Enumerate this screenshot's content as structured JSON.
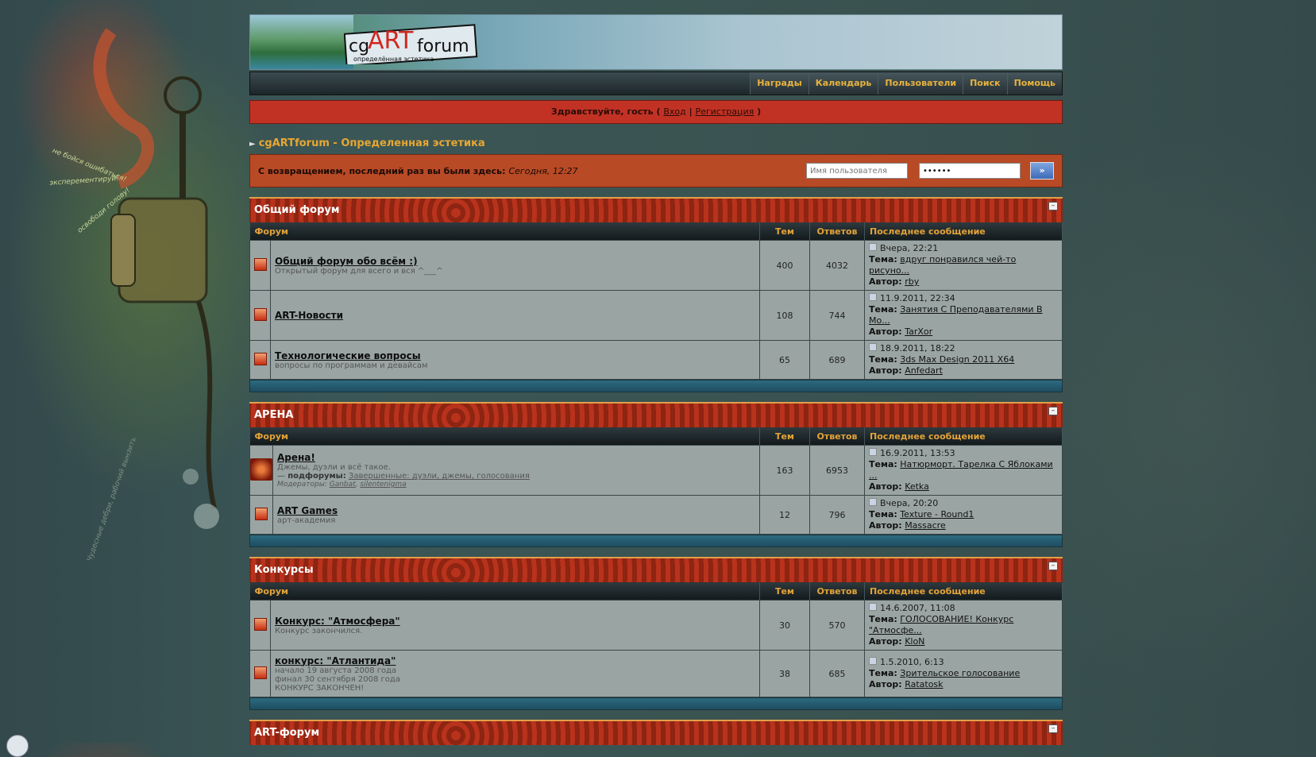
{
  "side_texts": [
    "не бойся ошибаться!",
    "эксперементируй!",
    "освободи голову!",
    "Чудесные дебри, рабочий вынзить"
  ],
  "logo": {
    "cg": "cg",
    "art": "ART",
    "forum": "forum",
    "tagline": "определённая эстетика"
  },
  "nav": [
    "Награды",
    "Календарь",
    "Пользователи",
    "Поиск",
    "Помощь"
  ],
  "welcome": {
    "greeting": "Здравствуйте, гость",
    "open": "(",
    "login": "Вход",
    "sep": "|",
    "register": "Регистрация",
    "close": ")"
  },
  "breadcrumb": "cgARTforum - Определенная эстетика",
  "loginbar": {
    "text": "С возвращением, последний раз вы были здесь:",
    "last_visit": "Сегодня, 12:27",
    "username_placeholder": "Имя пользователя",
    "password_value": "••••••",
    "go_label": "»"
  },
  "headers": {
    "forum": "Форум",
    "topics": "Тем",
    "replies": "Ответов",
    "last": "Последнее сообщение",
    "theme": "Тема:",
    "author": "Автор:"
  },
  "categories": [
    {
      "title": "Общий форум",
      "forums": [
        {
          "name": "Общий форум обо всём :)",
          "desc": "Открытый форум для всего и вся ^___^",
          "topics": "400",
          "replies": "4032",
          "date": "Вчера, 22:21",
          "topic": "вдруг понравился чей-то рисуно...",
          "author": "rby"
        },
        {
          "name": "ART-Новости",
          "desc": "",
          "topics": "108",
          "replies": "744",
          "date": "11.9.2011, 22:34",
          "topic": "Занятия С Преподавателями В Мо...",
          "author": "TarXor"
        },
        {
          "name": "Технологические вопросы",
          "desc": "вопросы по программам и девайсам",
          "topics": "65",
          "replies": "689",
          "date": "18.9.2011, 18:22",
          "topic": "3ds Max Design 2011 X64",
          "author": "Anfedart"
        }
      ]
    },
    {
      "title": "АРЕНА",
      "forums": [
        {
          "name": "Арена!",
          "desc": "Джемы, дуэли и всё такое.",
          "sub_label": "подфорумы:",
          "sub_dash": "—",
          "subforums": "Завершенные: дуэли, джемы, голосования",
          "mod_label": "Модераторы:",
          "moderators": [
            "Ganbat",
            "silentenigma"
          ],
          "topics": "163",
          "replies": "6953",
          "date": "16.9.2011, 13:53",
          "topic": "Натюрморт. Тарелка С Яблоками ...",
          "author": "Ketka"
        },
        {
          "name": "ART Games",
          "desc": "арт-академия",
          "topics": "12",
          "replies": "796",
          "date": "Вчера, 20:20",
          "topic": "Texture - Round1",
          "author": "Massacre"
        }
      ]
    },
    {
      "title": "Конкурсы",
      "forums": [
        {
          "name": "Конкурс: \"Атмосфера\"",
          "desc": "Конкурс закончился.",
          "topics": "30",
          "replies": "570",
          "date": "14.6.2007, 11:08",
          "topic": "ГОЛОСОВАНИЕ! Конкурс \"Атмосфе...",
          "author": "KloN"
        },
        {
          "name": "конкурс: \"Атлантида\"",
          "desc": "начало 19 августа 2008 года",
          "desc2": "финал 30 сентября 2008 года",
          "desc3": "КОНКУРС ЗАКОНЧЕН!",
          "topics": "38",
          "replies": "685",
          "date": "1.5.2010, 6:13",
          "topic": "Зрительское голосование",
          "author": "Ratatosk"
        }
      ]
    },
    {
      "title": "ART-форум"
    }
  ]
}
